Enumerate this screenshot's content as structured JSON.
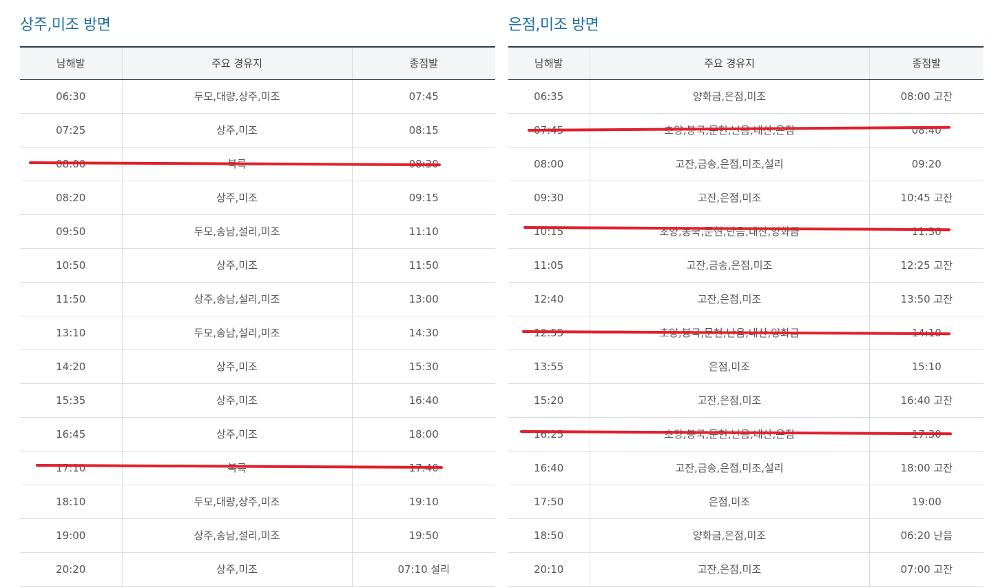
{
  "left": {
    "title": "상주,미조 방면",
    "headers": [
      "남해발",
      "주요 경유지",
      "종점발"
    ],
    "rows": [
      [
        "06:30",
        "두모,대량,상주,미조",
        "07:45"
      ],
      [
        "07:25",
        "상주,미조",
        "08:15"
      ],
      [
        "08:00",
        "복륵",
        "08:30"
      ],
      [
        "08:20",
        "상주,미조",
        "09:15"
      ],
      [
        "09:50",
        "두모,송남,설리,미조",
        "11:10"
      ],
      [
        "10:50",
        "상주,미조",
        "11:50"
      ],
      [
        "11:50",
        "상주,송남,설리,미조",
        "13:00"
      ],
      [
        "13:10",
        "두모,송남,설리,미조",
        "14:30"
      ],
      [
        "14:20",
        "상주,미조",
        "15:30"
      ],
      [
        "15:35",
        "상주,미조",
        "16:40"
      ],
      [
        "16:45",
        "상주,미조",
        "18:00"
      ],
      [
        "17:10",
        "복륵",
        "17:40"
      ],
      [
        "18:10",
        "두모,대량,상주,미조",
        "19:10"
      ],
      [
        "19:00",
        "상주,송남,설리,미조",
        "19:50"
      ],
      [
        "20:20",
        "상주,미조",
        "07:10 설리"
      ]
    ],
    "cancelled_rows": [
      2,
      11
    ]
  },
  "right": {
    "title": "은점,미조 방면",
    "headers": [
      "남해발",
      "주요 경유지",
      "종점발"
    ],
    "rows": [
      [
        "06:35",
        "양화금,은점,미조",
        "08:00 고잔"
      ],
      [
        "07:45",
        "초양,봉국,문현,난음,내산,은점",
        "08:40"
      ],
      [
        "08:00",
        "고잔,금송,은점,미조,설리",
        "09:20"
      ],
      [
        "09:30",
        "고잔,은점,미조",
        "10:45 고잔"
      ],
      [
        "10:15",
        "초양,봉국,문현,난음,내산,양화금",
        "11:30"
      ],
      [
        "11:05",
        "고잔,금송,은점,미조",
        "12:25 고잔"
      ],
      [
        "12:40",
        "고잔,은점,미조",
        "13:50 고잔"
      ],
      [
        "12:55",
        "초양,봉국,문현,난음,내산,양화금",
        "14:10"
      ],
      [
        "13:55",
        "은점,미조",
        "15:10"
      ],
      [
        "15:20",
        "고잔,은점,미조",
        "16:40 고잔"
      ],
      [
        "16:25",
        "초양,봉국,문현,난음,내산,은점",
        "17:30"
      ],
      [
        "16:40",
        "고잔,금송,은점,미조,설리",
        "18:00 고잔"
      ],
      [
        "17:50",
        "은점,미조",
        "19:00"
      ],
      [
        "18:50",
        "양화금,은점,미조",
        "06:20 난음"
      ],
      [
        "20:10",
        "고잔,은점,미조",
        "07:00 고잔"
      ]
    ],
    "cancelled_rows": [
      1,
      4,
      7,
      10
    ]
  },
  "colors": {
    "title": "#1f6ea5",
    "strike": "#e1202e",
    "header_bg": "#f4f5f7",
    "header_border": "#2e3d4f"
  }
}
